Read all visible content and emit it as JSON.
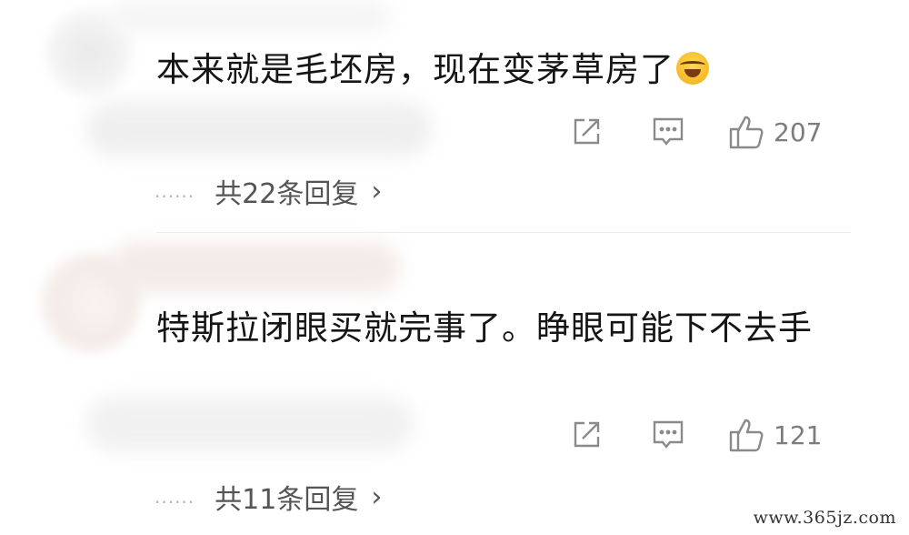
{
  "comments": [
    {
      "text": "本来就是毛坯房，现在变茅草房了",
      "emoji": "laughing-crying-emoji",
      "likes": "207",
      "replies_label": "共22条回复",
      "dots": "......",
      "chevron": "›"
    },
    {
      "text": "特斯拉闭眼买就完事了。睁眼可能下不去手",
      "likes": "121",
      "replies_label": "共11条回复",
      "dots": "......",
      "chevron": "›"
    }
  ],
  "watermark": "www.365jz.com",
  "colors": {
    "icon": "#8a8a8a",
    "text": "#151515",
    "reply_text": "#555555"
  }
}
